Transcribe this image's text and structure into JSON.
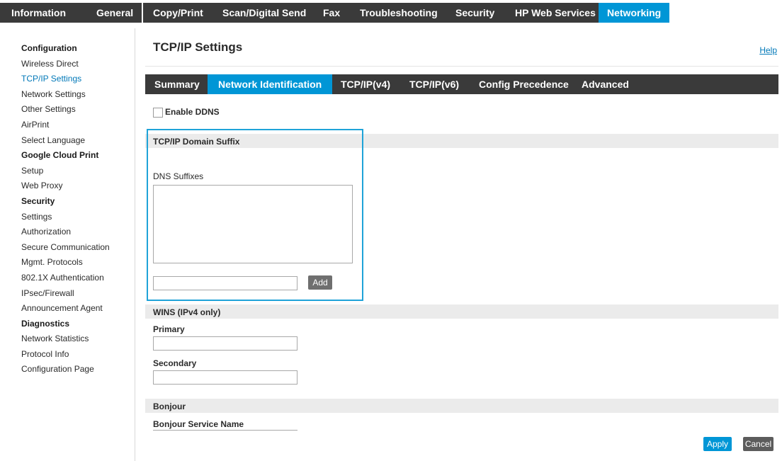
{
  "top_nav": {
    "tabs": [
      {
        "label": "Information"
      },
      {
        "label": "General"
      },
      {
        "label": "Copy/Print"
      },
      {
        "label": "Scan/Digital Send"
      },
      {
        "label": "Fax"
      },
      {
        "label": "Troubleshooting"
      },
      {
        "label": "Security"
      },
      {
        "label": "HP Web Services"
      },
      {
        "label": "Networking",
        "active": true
      }
    ]
  },
  "sidebar": {
    "items": [
      {
        "label": "Configuration",
        "type": "heading"
      },
      {
        "label": "Wireless Direct"
      },
      {
        "label": "TCP/IP Settings",
        "active": true
      },
      {
        "label": "Network Settings"
      },
      {
        "label": "Other Settings"
      },
      {
        "label": "AirPrint"
      },
      {
        "label": "Select Language"
      },
      {
        "label": "Google Cloud Print",
        "type": "heading"
      },
      {
        "label": "Setup"
      },
      {
        "label": "Web Proxy"
      },
      {
        "label": "Security",
        "type": "heading"
      },
      {
        "label": "Settings"
      },
      {
        "label": "Authorization"
      },
      {
        "label": "Secure Communication"
      },
      {
        "label": "Mgmt. Protocols"
      },
      {
        "label": "802.1X Authentication"
      },
      {
        "label": "IPsec/Firewall"
      },
      {
        "label": "Announcement Agent"
      },
      {
        "label": "Diagnostics",
        "type": "heading"
      },
      {
        "label": "Network Statistics"
      },
      {
        "label": "Protocol Info"
      },
      {
        "label": "Configuration Page"
      }
    ]
  },
  "main": {
    "page_title": "TCP/IP Settings",
    "help_label": "Help",
    "subtabs": [
      {
        "label": "Summary"
      },
      {
        "label": "Network Identification",
        "active": true
      },
      {
        "label": "TCP/IP(v4)"
      },
      {
        "label": "TCP/IP(v6)"
      },
      {
        "label": "Config Precedence"
      },
      {
        "label": "Advanced"
      }
    ],
    "enable_ddns_label": "Enable DDNS",
    "enable_ddns_checked": false,
    "domain_suffix": {
      "section_title": "TCP/IP Domain Suffix",
      "dns_suffixes_label": "DNS Suffixes",
      "suffix_input_value": "",
      "add_label": "Add"
    },
    "wins": {
      "section_title": "WINS (IPv4 only)",
      "primary_label": "Primary",
      "primary_value": "",
      "secondary_label": "Secondary",
      "secondary_value": ""
    },
    "bonjour": {
      "section_title": "Bonjour",
      "service_name_label": "Bonjour Service Name"
    },
    "footer": {
      "apply_label": "Apply",
      "cancel_label": "Cancel"
    }
  },
  "colors": {
    "nav_bg": "#3a3a3a",
    "accent": "#0096d6",
    "link": "#0078b8",
    "highlight_border": "#1fa3d8"
  }
}
